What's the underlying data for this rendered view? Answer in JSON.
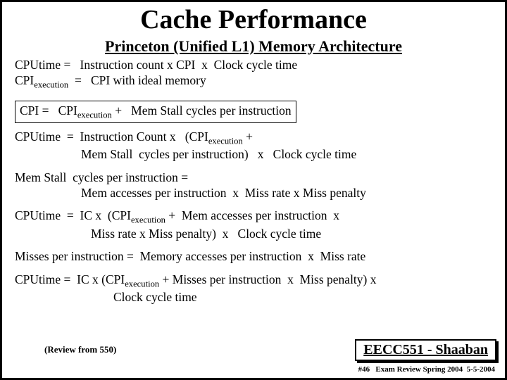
{
  "title": "Cache Performance",
  "subtitle": "Princeton (Unified L1) Memory Architecture",
  "line1a": "CPUtime =   Instruction count x CPI  x  Clock cycle time",
  "line1b_pre": "CPI",
  "line1b_sub": "execution",
  "line1b_post": "  =   CPI with ideal memory",
  "boxed_pre": "CPI =   CPI",
  "boxed_sub": "execution",
  "boxed_post": " +   Mem Stall cycles per instruction",
  "l3a_pre": "CPUtime  =  Instruction Count x   (CPI",
  "l3a_sub": "execution",
  "l3a_post": " +",
  "l3b": "Mem Stall  cycles per instruction)   x   Clock cycle time",
  "l4a": "Mem Stall  cycles per instruction =",
  "l4b": "Mem accesses per instruction  x  Miss rate x Miss penalty",
  "l5a_pre": "CPUtime  =  IC x  (CPI",
  "l5a_sub": "execution",
  "l5a_post": " +  Mem accesses per instruction  x",
  "l5b": "Miss rate x Miss penalty)  x   Clock cycle time",
  "l6": "Misses per instruction =  Memory accesses per instruction  x  Miss rate",
  "l7a_pre": "CPUtime =  IC x (CPI",
  "l7a_sub": "execution",
  "l7a_post": " + Misses per instruction  x  Miss penalty) x",
  "l7b": "Clock cycle time",
  "review": "(Review from 550)",
  "badge": "EECC551 - Shaaban",
  "footer": "#46   Exam Review Spring 2004  5-5-2004"
}
